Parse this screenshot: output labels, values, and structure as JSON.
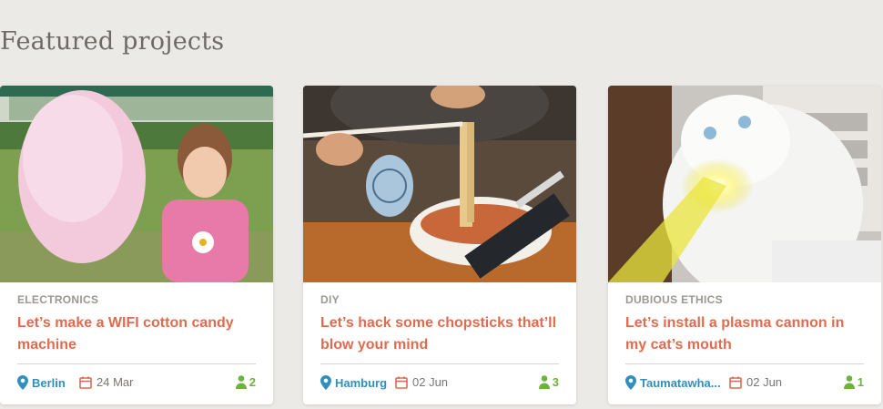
{
  "section": {
    "title": "Featured projects"
  },
  "colors": {
    "background": "#eceae6",
    "title_accent": "#e06b4e",
    "location": "#2f8fbd",
    "members": "#6cb33e",
    "calendar": "#e06b4e"
  },
  "icons": {
    "location": "map-pin-icon",
    "date": "calendar-icon",
    "members": "person-icon"
  },
  "cards": [
    {
      "category": "ELECTRONICS",
      "title": "Let’s make a WIFI cotton candy machine",
      "location": "Berlin",
      "date": "24 Mar",
      "members": "2"
    },
    {
      "category": "DIY",
      "title": "Let’s hack some chopsticks that’ll blow your mind",
      "location": "Hamburg",
      "date": "02 Jun",
      "members": "3"
    },
    {
      "category": "DUBIOUS ETHICS",
      "title": "Let’s install a plasma cannon in my cat’s mouth",
      "location": "Taumatawha...",
      "date": "02 Jun",
      "members": "1"
    }
  ]
}
